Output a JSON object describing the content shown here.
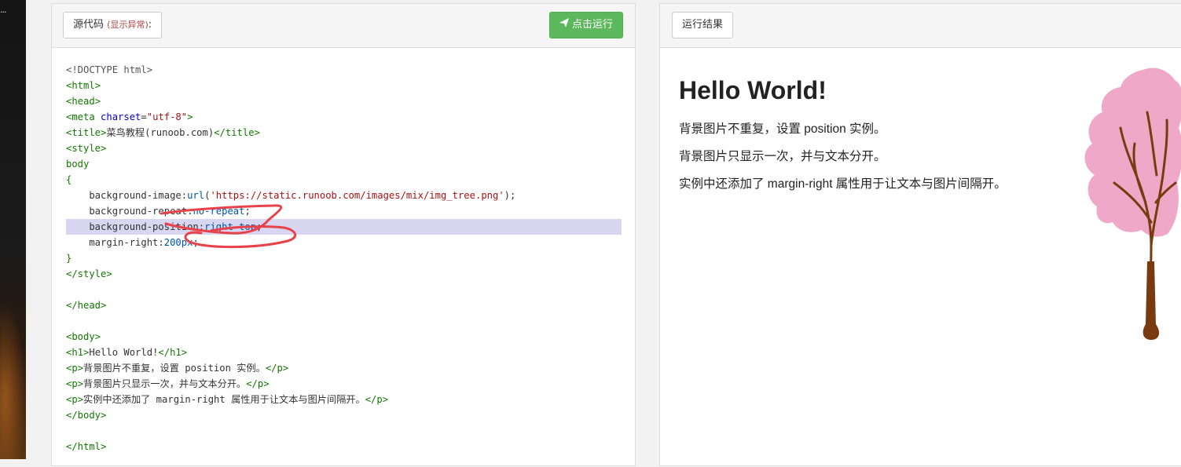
{
  "code_panel": {
    "source_label": "源代码",
    "source_note": "(显示异常)",
    "source_suffix": ":",
    "run_label": "点击运行",
    "lines": [
      "<!DOCTYPE html>",
      "<html>",
      "<head>",
      "<meta charset=\"utf-8\">",
      "<title>菜鸟教程(runoob.com)</title>",
      "<style>",
      "body",
      "{",
      "    background-image:url('https://static.runoob.com/images/mix/img_tree.png');",
      "    background-repeat:no-repeat;",
      "    background-position:right top;",
      "    margin-right:200px;",
      "}",
      "</style>",
      "",
      "</head>",
      "",
      "<body>",
      "<h1>Hello World!</h1>",
      "<p>背景图片不重复，设置 position 实例。</p>",
      "<p>背景图片只显示一次，并与文本分开。</p>",
      "<p>实例中还添加了 margin-right 属性用于让文本与图片间隔开。</p>",
      "</body>",
      "",
      "</html>"
    ],
    "highlighted_line": 10
  },
  "result_panel": {
    "title_label": "运行结果",
    "heading": "Hello World!",
    "paragraphs": [
      "背景图片不重复，设置 position 实例。",
      "背景图片只显示一次，并与文本分开。",
      "实例中还添加了 margin-right 属性用于让文本与图片间隔开。"
    ]
  },
  "colors": {
    "run_button": "#5cb85c",
    "highlight_line": "#d8d6f0",
    "annotation": "#e8424a",
    "tree_blossom": "#f0a8c8",
    "tree_trunk": "#7a3a10"
  },
  "icons": {
    "run": "paper-plane-icon"
  }
}
